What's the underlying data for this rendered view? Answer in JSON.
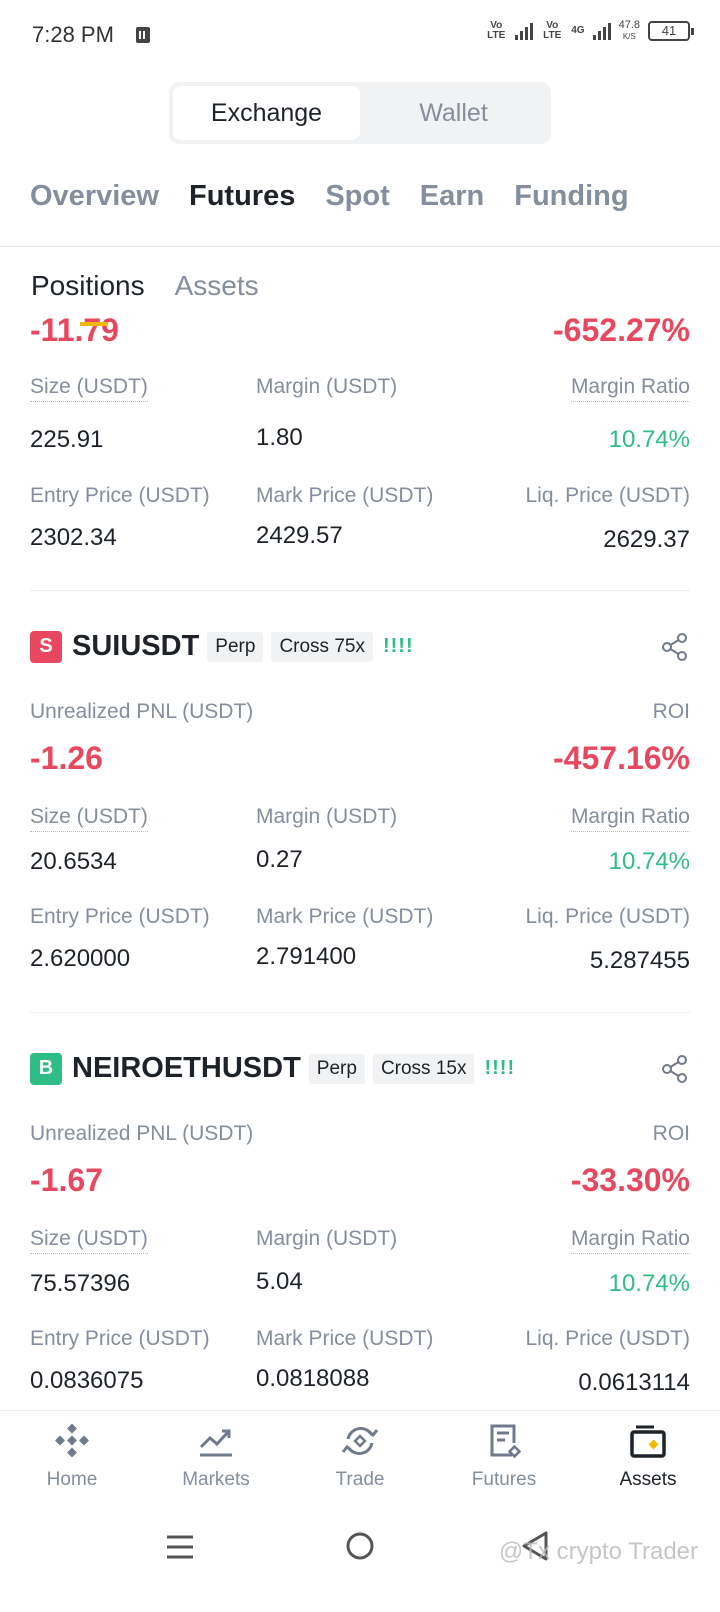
{
  "status": {
    "time": "7:28 PM",
    "net1": "Vo LTE",
    "net2": "Vo LTE",
    "net3": "4G",
    "speed_value": "47.8",
    "speed_unit": "K/S",
    "battery": "41"
  },
  "segment": {
    "exchange": "Exchange",
    "wallet": "Wallet"
  },
  "main_tabs": {
    "overview": "Overview",
    "futures": "Futures",
    "spot": "Spot",
    "earn": "Earn",
    "funding": "Funding"
  },
  "sub_tabs": {
    "positions": "Positions",
    "assets": "Assets"
  },
  "labels": {
    "unrealized_pnl": "Unrealized PNL (USDT)",
    "roi": "ROI",
    "size": "Size (USDT)",
    "margin": "Margin (USDT)",
    "margin_ratio": "Margin Ratio",
    "entry_price": "Entry Price (USDT)",
    "mark_price": "Mark Price (USDT)",
    "liq_price": "Liq. Price (USDT)"
  },
  "positions": [
    {
      "pnl": "-11.79",
      "roi": "-652.27%",
      "size": "225.91",
      "margin": "1.80",
      "margin_ratio": "10.74%",
      "entry_price": "2302.34",
      "mark_price": "2429.57",
      "liq_price": "2629.37"
    },
    {
      "badge": "S",
      "symbol": "SUIUSDT",
      "type": "Perp",
      "leverage": "Cross 75x",
      "risk": "!!!!",
      "pnl": "-1.26",
      "roi": "-457.16%",
      "size": "20.6534",
      "margin": "0.27",
      "margin_ratio": "10.74%",
      "entry_price": "2.620000",
      "mark_price": "2.791400",
      "liq_price": "5.287455"
    },
    {
      "badge": "B",
      "symbol": "NEIROETHUSDT",
      "type": "Perp",
      "leverage": "Cross 15x",
      "risk": "!!!!",
      "pnl": "-1.67",
      "roi": "-33.30%",
      "size": "75.57396",
      "margin": "5.04",
      "margin_ratio": "10.74%",
      "entry_price": "0.0836075",
      "mark_price": "0.0818088",
      "liq_price": "0.0613114"
    }
  ],
  "nav": {
    "home": "Home",
    "markets": "Markets",
    "trade": "Trade",
    "futures": "Futures",
    "assets": "Assets"
  },
  "colors": {
    "red": "#e8485f",
    "green": "#2ebd85",
    "yellow": "#f0b90b",
    "gray": "#848e9c"
  },
  "icons": [
    "sim-icon",
    "signal-icon",
    "battery-icon",
    "share-icon",
    "home-icon",
    "markets-icon",
    "trade-icon",
    "futures-icon",
    "assets-icon",
    "menu-icon",
    "circle-home-icon",
    "back-icon"
  ],
  "watermark": "@Tx crypto Trader"
}
